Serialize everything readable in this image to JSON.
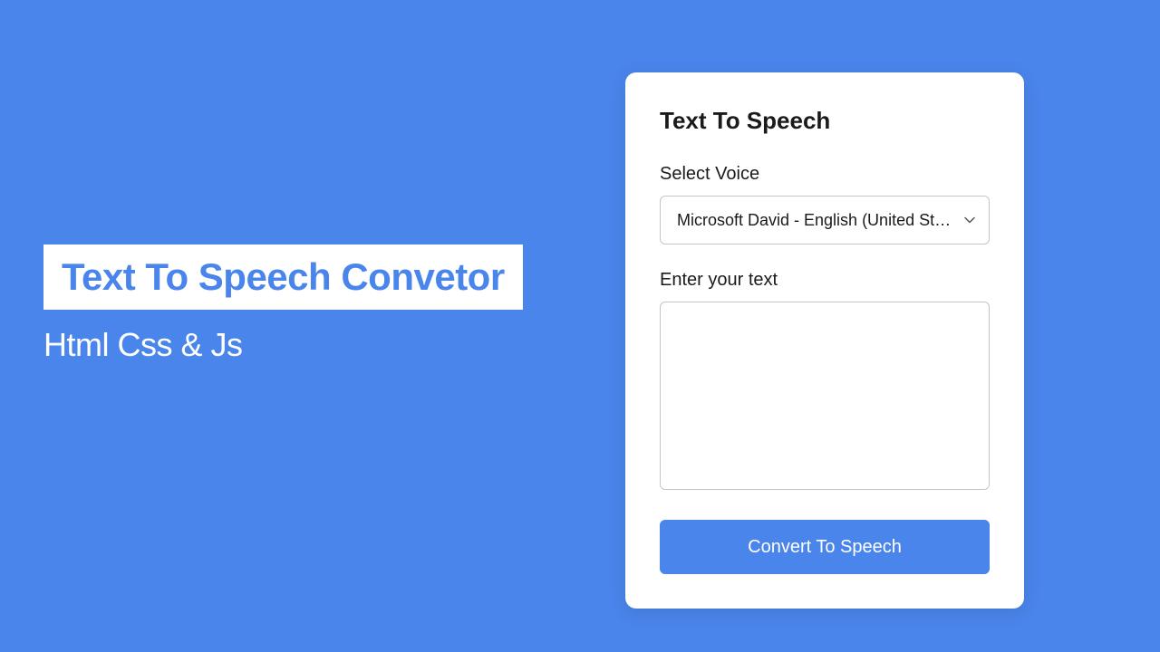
{
  "hero": {
    "title": "Text To Speech Convetor",
    "subtitle": "Html Css & Js"
  },
  "card": {
    "title": "Text To Speech",
    "voice_label": "Select Voice",
    "voice_selected": "Microsoft David - English (United States)",
    "text_label": "Enter your text",
    "text_value": "",
    "button_label": "Convert To Speech"
  },
  "colors": {
    "primary": "#4a85eb",
    "card_bg": "#ffffff",
    "text_dark": "#1a1a1a"
  }
}
